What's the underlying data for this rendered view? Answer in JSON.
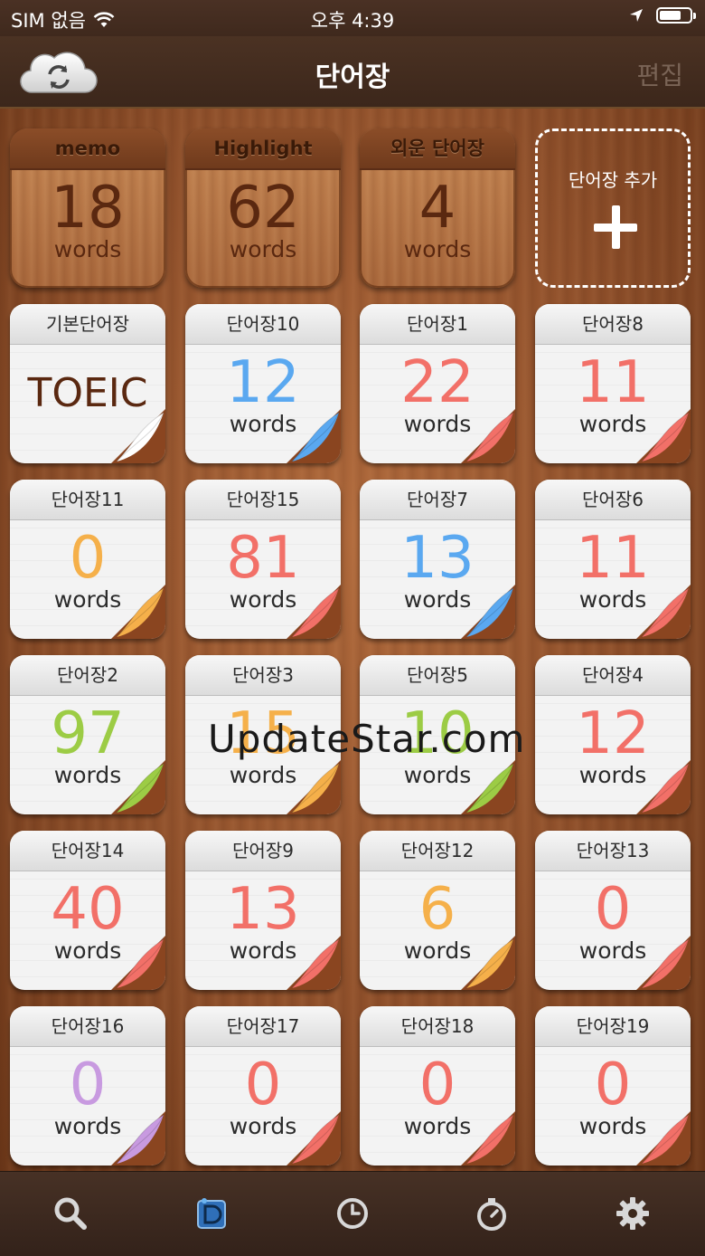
{
  "status_bar": {
    "carrier": "SIM 없음",
    "time": "오후 4:39",
    "battery_level": 0.72
  },
  "nav": {
    "title": "단어장",
    "edit_label": "편집",
    "left_icon": "cloud-sync-icon"
  },
  "top_cards": [
    {
      "title": "memo",
      "count": "18",
      "unit": "words"
    },
    {
      "title": "Highlight",
      "count": "62",
      "unit": "words"
    },
    {
      "title": "외운 단어장",
      "count": "4",
      "unit": "words"
    }
  ],
  "add_card": {
    "label": "단어장 추가"
  },
  "word_books": [
    {
      "title": "기본단어장",
      "text": "TOEIC",
      "color": "#ffffff"
    },
    {
      "title": "단어장10",
      "count": "12",
      "unit": "words",
      "color": "#5aa8f0"
    },
    {
      "title": "단어장1",
      "count": "22",
      "unit": "words",
      "color": "#f27068"
    },
    {
      "title": "단어장8",
      "count": "11",
      "unit": "words",
      "color": "#f27068"
    },
    {
      "title": "단어장11",
      "count": "0",
      "unit": "words",
      "color": "#f5b04a"
    },
    {
      "title": "단어장15",
      "count": "81",
      "unit": "words",
      "color": "#f27068"
    },
    {
      "title": "단어장7",
      "count": "13",
      "unit": "words",
      "color": "#5aa8f0"
    },
    {
      "title": "단어장6",
      "count": "11",
      "unit": "words",
      "color": "#f27068"
    },
    {
      "title": "단어장2",
      "count": "97",
      "unit": "words",
      "color": "#9ccc45"
    },
    {
      "title": "단어장3",
      "count": "15",
      "unit": "words",
      "color": "#f5b04a"
    },
    {
      "title": "단어장5",
      "count": "10",
      "unit": "words",
      "color": "#9ccc45"
    },
    {
      "title": "단어장4",
      "count": "12",
      "unit": "words",
      "color": "#f27068"
    },
    {
      "title": "단어장14",
      "count": "40",
      "unit": "words",
      "color": "#f27068"
    },
    {
      "title": "단어장9",
      "count": "13",
      "unit": "words",
      "color": "#f27068"
    },
    {
      "title": "단어장12",
      "count": "6",
      "unit": "words",
      "color": "#f5b04a"
    },
    {
      "title": "단어장13",
      "count": "0",
      "unit": "words",
      "color": "#f27068"
    },
    {
      "title": "단어장16",
      "count": "0",
      "unit": "words",
      "color": "#c89ae0"
    },
    {
      "title": "단어장17",
      "count": "0",
      "unit": "words",
      "color": "#f27068"
    },
    {
      "title": "단어장18",
      "count": "0",
      "unit": "words",
      "color": "#f27068"
    },
    {
      "title": "단어장19",
      "count": "0",
      "unit": "words",
      "color": "#f27068"
    }
  ],
  "watermark": "UpdateStar.com",
  "tab_bar": [
    {
      "icon": "search-icon"
    },
    {
      "icon": "wordbook-icon"
    },
    {
      "icon": "clock-icon"
    },
    {
      "icon": "stopwatch-icon"
    },
    {
      "icon": "gear-icon"
    }
  ]
}
